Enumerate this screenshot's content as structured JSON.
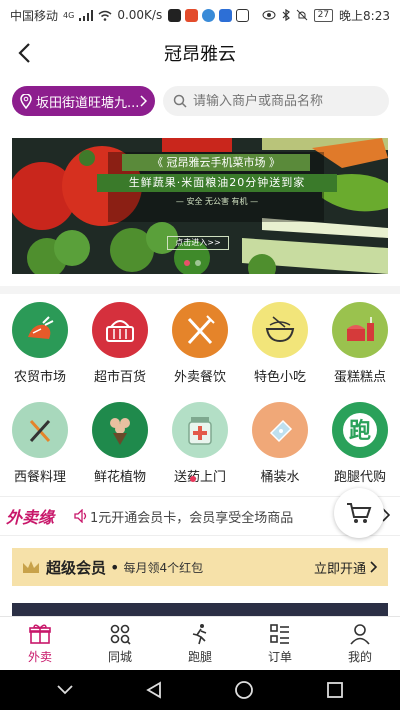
{
  "statusbar": {
    "carrier": "中国移动",
    "network": "4G",
    "speed": "0.00K/s",
    "battery": "27",
    "time": "晚上8:23"
  },
  "header": {
    "title": "冠昂雅云"
  },
  "location": {
    "label": "坂田街道旺塘九..."
  },
  "search": {
    "placeholder": "请输入商户或商品名称"
  },
  "banner": {
    "heading": "《 冠昂雅云手机菜市场 》",
    "tagline": "生鲜蔬果·米面粮油20分钟送到家",
    "badges": "— 安全 无公害 有机 —",
    "cta": "点击进入>>",
    "active_slide": 1,
    "slide_count": 2
  },
  "categories": [
    {
      "label": "农贸市场",
      "icon": "produce-icon",
      "color": "#2b9a57"
    },
    {
      "label": "超市百货",
      "icon": "basket-icon",
      "color": "#d5303d"
    },
    {
      "label": "外卖餐饮",
      "icon": "fork-knife-icon",
      "color": "#e5842a"
    },
    {
      "label": "特色小吃",
      "icon": "noodle-bowl-icon",
      "color": "#f2e57a"
    },
    {
      "label": "蛋糕糕点",
      "icon": "cake-icon",
      "color": "#9ac24e"
    },
    {
      "label": "西餐料理",
      "icon": "western-food-icon",
      "color": "#a8d8bc"
    },
    {
      "label": "鲜花植物",
      "icon": "flower-icon",
      "color": "#1f8a4c"
    },
    {
      "label": "送药上门",
      "icon": "medicine-icon",
      "color": "#b3dfc6"
    },
    {
      "label": "桶装水",
      "icon": "water-icon",
      "color": "#f0a878"
    },
    {
      "label": "跑腿代购",
      "icon": "errand-icon",
      "color": "#2aa15a"
    }
  ],
  "notice": {
    "brand": "外卖缘",
    "text": "1元开通会员卡，会员享受全场商品"
  },
  "vip": {
    "title": "超级会员",
    "subtitle": "每月领4个红包",
    "action": "立即开通"
  },
  "tabs": [
    {
      "label": "外卖",
      "icon": "gift-icon",
      "active": true
    },
    {
      "label": "同城",
      "icon": "grid-icon",
      "active": false
    },
    {
      "label": "跑腿",
      "icon": "runner-icon",
      "active": false
    },
    {
      "label": "订单",
      "icon": "order-list-icon",
      "active": false
    },
    {
      "label": "我的",
      "icon": "person-icon",
      "active": false
    }
  ],
  "colors": {
    "accent": "#c8176a",
    "location_pill": "#8d1e8e",
    "vip_background": "#f6e1a9"
  }
}
